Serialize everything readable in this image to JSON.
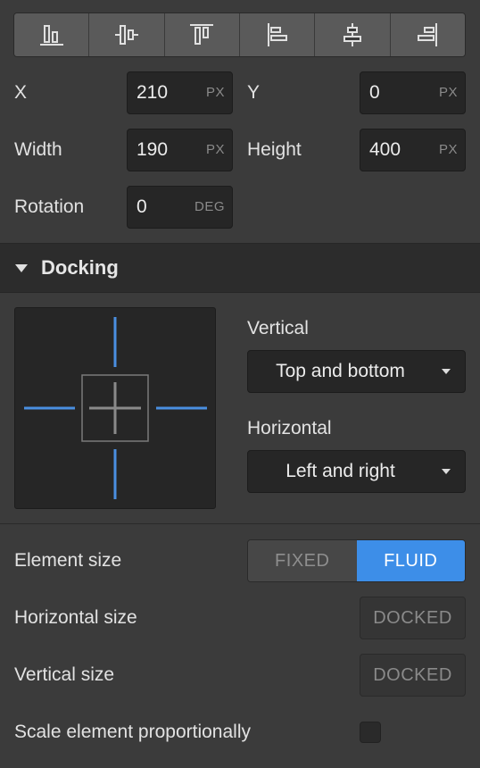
{
  "align_toolbar": {
    "buttons": [
      {
        "icon": "align-bottom-icon"
      },
      {
        "icon": "align-vertical-center-icon"
      },
      {
        "icon": "align-top-icon"
      },
      {
        "icon": "align-left-icon"
      },
      {
        "icon": "align-horizontal-center-icon"
      },
      {
        "icon": "align-right-icon"
      }
    ]
  },
  "position": {
    "x_label": "X",
    "x_value": "210",
    "x_unit": "PX",
    "y_label": "Y",
    "y_value": "0",
    "y_unit": "PX",
    "width_label": "Width",
    "width_value": "190",
    "width_unit": "PX",
    "height_label": "Height",
    "height_value": "400",
    "height_unit": "PX",
    "rotation_label": "Rotation",
    "rotation_value": "0",
    "rotation_unit": "DEG"
  },
  "docking": {
    "title": "Docking",
    "vertical_label": "Vertical",
    "vertical_value": "Top and bottom",
    "horizontal_label": "Horizontal",
    "horizontal_value": "Left and right",
    "active_color": "#4a8fe0"
  },
  "sizing": {
    "element_size_label": "Element size",
    "fixed_label": "FIXED",
    "fluid_label": "FLUID",
    "selected": "FLUID",
    "horizontal_size_label": "Horizontal size",
    "horizontal_size_value": "DOCKED",
    "vertical_size_label": "Vertical size",
    "vertical_size_value": "DOCKED",
    "scale_label": "Scale element proportionally",
    "scale_checked": false
  }
}
